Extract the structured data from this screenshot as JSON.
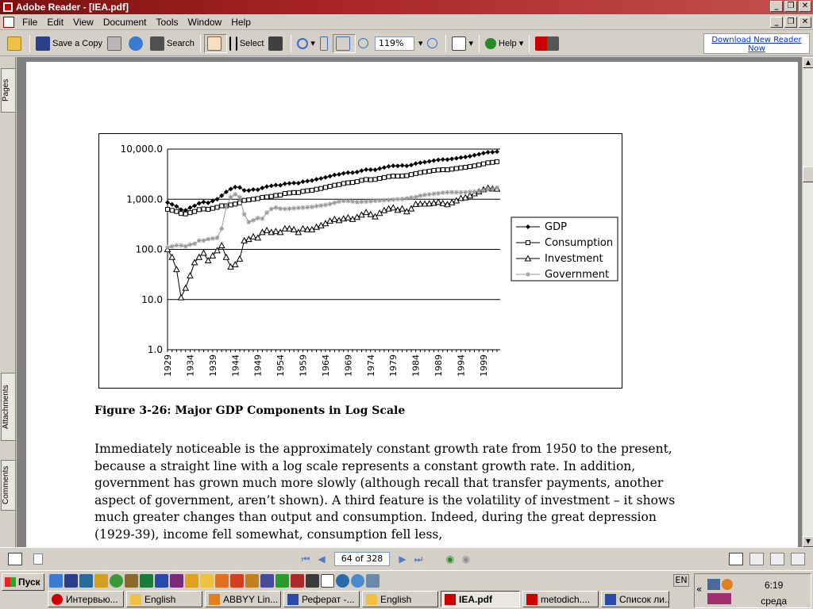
{
  "window": {
    "title": "Adobe Reader - [IEA.pdf]"
  },
  "menu": [
    "File",
    "Edit",
    "View",
    "Document",
    "Tools",
    "Window",
    "Help"
  ],
  "toolbar": {
    "save_copy": "Save a Copy",
    "search": "Search",
    "select": "Select",
    "zoom": "119%",
    "help": "Help",
    "download_line1": "Download New Reader",
    "download_line2": "Now"
  },
  "left_tabs": {
    "pages": "Pages",
    "attachments": "Attachments",
    "comments": "Comments"
  },
  "document": {
    "caption": "Figure 3-26: Major GDP Components in Log Scale",
    "paragraph": "Immediately noticeable is the approximately constant growth rate from 1950 to the present, because a straight line with a log scale represents a constant growth rate.  In addition, government has grown much more slowly (although recall that transfer payments, another aspect of government, aren’t shown).  A third feature is the volatility of investment – it shows much greater changes than output and consumption.  Indeed, during the great depression (1929-39), income fell somewhat, consumption fell less,"
  },
  "chart_data": {
    "type": "line",
    "title": "",
    "xlabel": "",
    "ylabel": "",
    "y_scale": "log",
    "ylim": [
      1.0,
      10000.0
    ],
    "y_ticks": [
      "10,000.0",
      "1,000.0",
      "100.0",
      "10.0",
      "1.0"
    ],
    "x_ticks": [
      "1929",
      "1934",
      "1939",
      "1944",
      "1949",
      "1954",
      "1959",
      "1964",
      "1969",
      "1974",
      "1979",
      "1984",
      "1989",
      "1994",
      "1999"
    ],
    "x": [
      1929,
      1930,
      1931,
      1932,
      1933,
      1934,
      1935,
      1936,
      1937,
      1938,
      1939,
      1940,
      1941,
      1942,
      1943,
      1944,
      1945,
      1946,
      1947,
      1948,
      1949,
      1950,
      1951,
      1952,
      1953,
      1954,
      1955,
      1956,
      1957,
      1958,
      1959,
      1960,
      1961,
      1962,
      1963,
      1964,
      1965,
      1966,
      1967,
      1968,
      1969,
      1970,
      1971,
      1972,
      1973,
      1974,
      1975,
      1976,
      1977,
      1978,
      1979,
      1980,
      1981,
      1982,
      1983,
      1984,
      1985,
      1986,
      1987,
      1988,
      1989,
      1990,
      1991,
      1992,
      1993,
      1994,
      1995,
      1996,
      1997,
      1998,
      1999,
      2000,
      2001,
      2002
    ],
    "legend_position": "right",
    "gridlines": "horizontal",
    "series": [
      {
        "name": "GDP",
        "marker": "diamond",
        "color": "#000000",
        "values": [
          865,
          790,
          720,
          620,
          600,
          680,
          740,
          830,
          880,
          850,
          920,
          1000,
          1180,
          1400,
          1600,
          1750,
          1720,
          1500,
          1490,
          1560,
          1550,
          1680,
          1790,
          1850,
          1920,
          1900,
          2030,
          2070,
          2110,
          2090,
          2240,
          2300,
          2360,
          2500,
          2600,
          2730,
          2870,
          3050,
          3130,
          3280,
          3390,
          3390,
          3500,
          3700,
          3900,
          3880,
          3860,
          4080,
          4280,
          4500,
          4630,
          4620,
          4730,
          4620,
          4800,
          5140,
          5330,
          5480,
          5680,
          5900,
          6100,
          6200,
          6170,
          6380,
          6550,
          6800,
          6950,
          7200,
          7550,
          7900,
          8300,
          8650,
          8680,
          8900
        ]
      },
      {
        "name": "Consumption",
        "marker": "square-open",
        "color": "#000000",
        "values": [
          630,
          600,
          570,
          520,
          510,
          540,
          570,
          620,
          640,
          630,
          660,
          690,
          740,
          740,
          770,
          800,
          850,
          950,
          970,
          1000,
          1030,
          1090,
          1110,
          1140,
          1190,
          1210,
          1300,
          1330,
          1360,
          1360,
          1440,
          1480,
          1510,
          1580,
          1640,
          1720,
          1810,
          1900,
          1960,
          2060,
          2130,
          2160,
          2240,
          2380,
          2470,
          2450,
          2480,
          2600,
          2710,
          2830,
          2890,
          2880,
          2910,
          2950,
          3100,
          3250,
          3400,
          3510,
          3620,
          3750,
          3820,
          3880,
          3860,
          3980,
          4100,
          4230,
          4340,
          4470,
          4620,
          4840,
          5080,
          5330,
          5440,
          5610
        ]
      },
      {
        "name": "Investment",
        "marker": "triangle-open",
        "color": "#000000",
        "values": [
          100,
          70,
          40,
          11,
          17,
          30,
          55,
          70,
          85,
          60,
          75,
          95,
          120,
          70,
          45,
          50,
          65,
          150,
          160,
          180,
          170,
          220,
          240,
          220,
          230,
          220,
          260,
          260,
          250,
          220,
          260,
          250,
          250,
          280,
          300,
          330,
          370,
          400,
          380,
          410,
          430,
          400,
          440,
          490,
          550,
          500,
          450,
          530,
          600,
          650,
          680,
          610,
          650,
          570,
          650,
          800,
          810,
          810,
          820,
          840,
          880,
          830,
          790,
          860,
          940,
          1050,
          1080,
          1180,
          1300,
          1420,
          1560,
          1680,
          1620,
          1610
        ]
      },
      {
        "name": "Government",
        "marker": "asterisk",
        "color": "#999999",
        "values": [
          110,
          115,
          120,
          120,
          115,
          125,
          130,
          150,
          150,
          160,
          165,
          170,
          260,
          700,
          1100,
          1250,
          1100,
          500,
          350,
          380,
          420,
          410,
          540,
          640,
          680,
          650,
          640,
          650,
          660,
          670,
          680,
          690,
          700,
          730,
          750,
          770,
          800,
          850,
          900,
          920,
          920,
          900,
          880,
          890,
          900,
          910,
          930,
          940,
          950,
          960,
          980,
          1000,
          1010,
          1040,
          1080,
          1110,
          1180,
          1220,
          1250,
          1280,
          1310,
          1350,
          1370,
          1380,
          1370,
          1370,
          1380,
          1400,
          1420,
          1450,
          1500,
          1550,
          1600,
          1700
        ]
      }
    ]
  },
  "navbar": {
    "page_display": "64 of 328"
  },
  "taskbar": {
    "start": "Пуск",
    "lang": "EN",
    "time": "6:19",
    "day": "среда",
    "tasks": [
      "Интервью...",
      "English",
      "ABBYY Lin...",
      "Реферат -...",
      "English",
      "IEA.pdf",
      "metodich....",
      "Список ли..."
    ]
  },
  "colors": {
    "titlebar": "#a82424",
    "chrome": "#d4d0c8",
    "link": "#0033cc"
  }
}
